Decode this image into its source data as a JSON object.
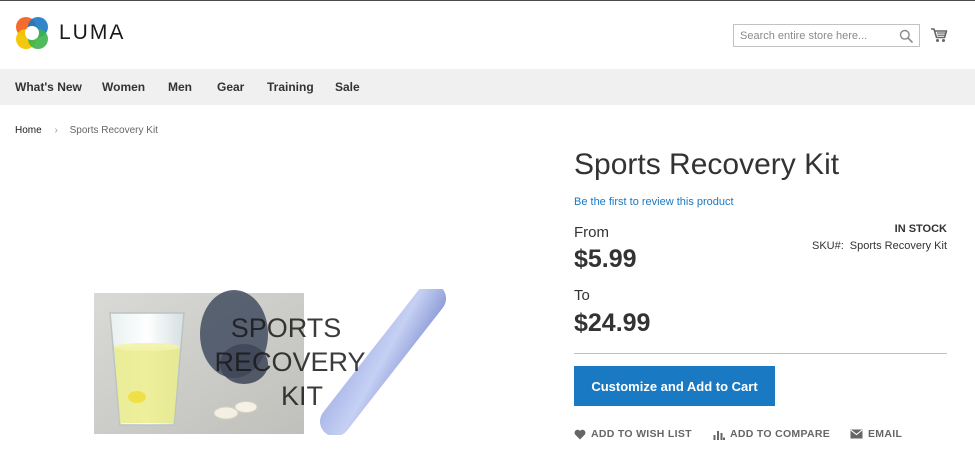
{
  "brand": {
    "name": "LUMA"
  },
  "search": {
    "placeholder": "Search entire store here..."
  },
  "nav": {
    "items": [
      "What's New",
      "Women",
      "Men",
      "Gear",
      "Training",
      "Sale"
    ]
  },
  "breadcrumb": {
    "home": "Home",
    "current": "Sports Recovery Kit"
  },
  "product": {
    "title": "Sports Recovery Kit",
    "review_link": "Be the first to review this product",
    "stock_status": "In stock",
    "sku_label": "SKU#:",
    "sku_value": "Sports Recovery Kit",
    "price_from_label": "From",
    "price_from": "$5.99",
    "price_to_label": "To",
    "price_to": "$24.99",
    "image_text": [
      "SPORTS",
      "RECOVERY",
      "KIT"
    ]
  },
  "actions": {
    "add_to_cart": "Customize and Add to Cart",
    "wish_list": "ADD TO WISH LIST",
    "compare": "ADD TO COMPARE",
    "email": "EMAIL"
  },
  "colors": {
    "accent": "#1979c3",
    "nav_bg": "#f0f0f0"
  },
  "icons": [
    "logo-icon",
    "search-icon",
    "cart-icon",
    "chevron-right-icon",
    "heart-icon",
    "compare-icon",
    "envelope-icon"
  ]
}
